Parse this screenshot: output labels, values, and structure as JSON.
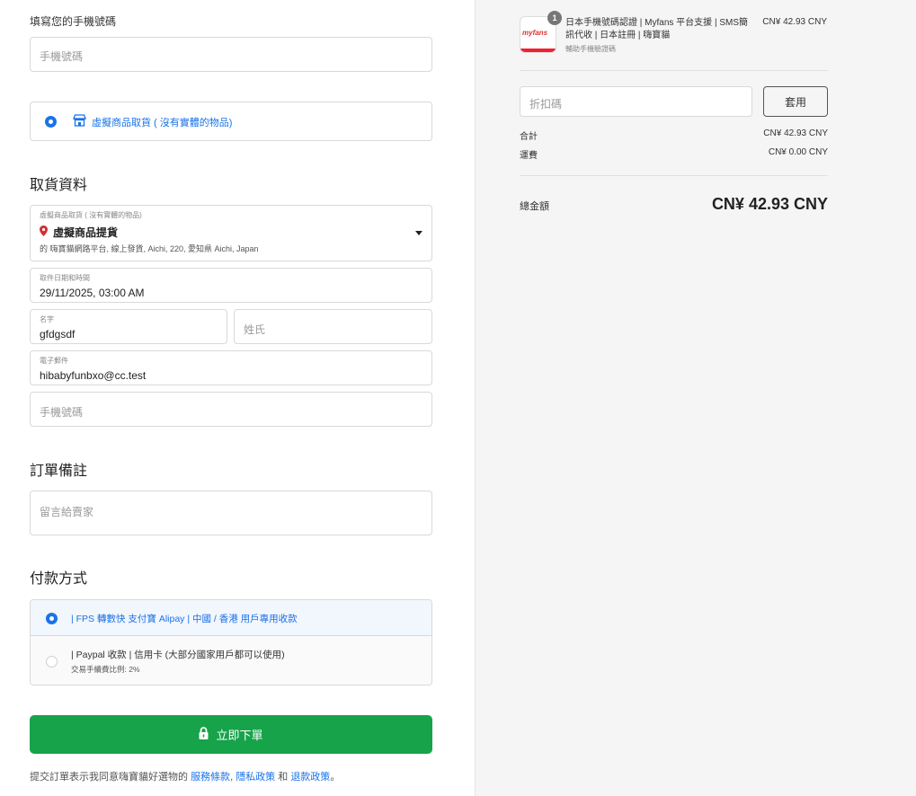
{
  "contact": {
    "heading": "填寫您的手機號碼",
    "phone_placeholder": "手機號碼"
  },
  "delivery_option": {
    "label": "虛擬商品取貨 ( 沒有實體的物品)"
  },
  "pickup": {
    "title": "取貨資料",
    "location": {
      "label": "虛擬商品取貨 ( 沒有實體的物品)",
      "name": "虛擬商品提貨",
      "address": "的 嗨寶貓網路平台, 線上發貨, Aichi, 220, 愛知県 Aichi, Japan"
    },
    "datetime": {
      "label": "取件日期和時間",
      "value": "29/11/2025, 03:00 AM"
    },
    "first_name": {
      "label": "名字",
      "value": "gfdgsdf"
    },
    "last_name": {
      "placeholder": "姓氏"
    },
    "email": {
      "label": "電子郵件",
      "value": "hibabyfunbxo@cc.test"
    },
    "phone": {
      "placeholder": "手機號碼"
    }
  },
  "notes": {
    "title": "訂單備註",
    "placeholder": "留言給賣家"
  },
  "payment": {
    "title": "付款方式",
    "options": [
      {
        "label": "| FPS 轉數快 支付寶 Alipay | 中國 / 香港 用戶專用收款",
        "selected": true
      },
      {
        "label": "| Paypal 收款 | 信用卡 (大部分國家用戶都可以使用)",
        "note": "交易手續費比例: 2%",
        "selected": false
      }
    ]
  },
  "submit": {
    "label": "立即下單",
    "icon": "lock-icon"
  },
  "footer": {
    "prefix": "提交訂單表示我同意嗨寶貓好選物的",
    "terms": "服務條款",
    "comma": ",",
    "privacy": "隱私政策",
    "and": "和",
    "refund": "退款政策",
    "end": "。"
  },
  "summary": {
    "product": {
      "quantity": "1",
      "logo_text": "myfans",
      "title": "日本手機號碼認證 | Myfans 平台支援 | SMS簡訊代收 | 日本註冊 | 嗨寶貓",
      "subtitle": "輔助手機驗證碼",
      "price": "CN¥ 42.93 CNY"
    },
    "discount_placeholder": "折扣碼",
    "apply_label": "套用",
    "subtotal_label": "合計",
    "subtotal_value": "CN¥ 42.93 CNY",
    "shipping_label": "運費",
    "shipping_value": "CN¥ 0.00 CNY",
    "total_label": "總金額",
    "total_value": "CN¥ 42.93 CNY"
  },
  "colors": {
    "accent": "#1a73e8",
    "submit": "#17a34a",
    "pin": "#d32f2f"
  }
}
